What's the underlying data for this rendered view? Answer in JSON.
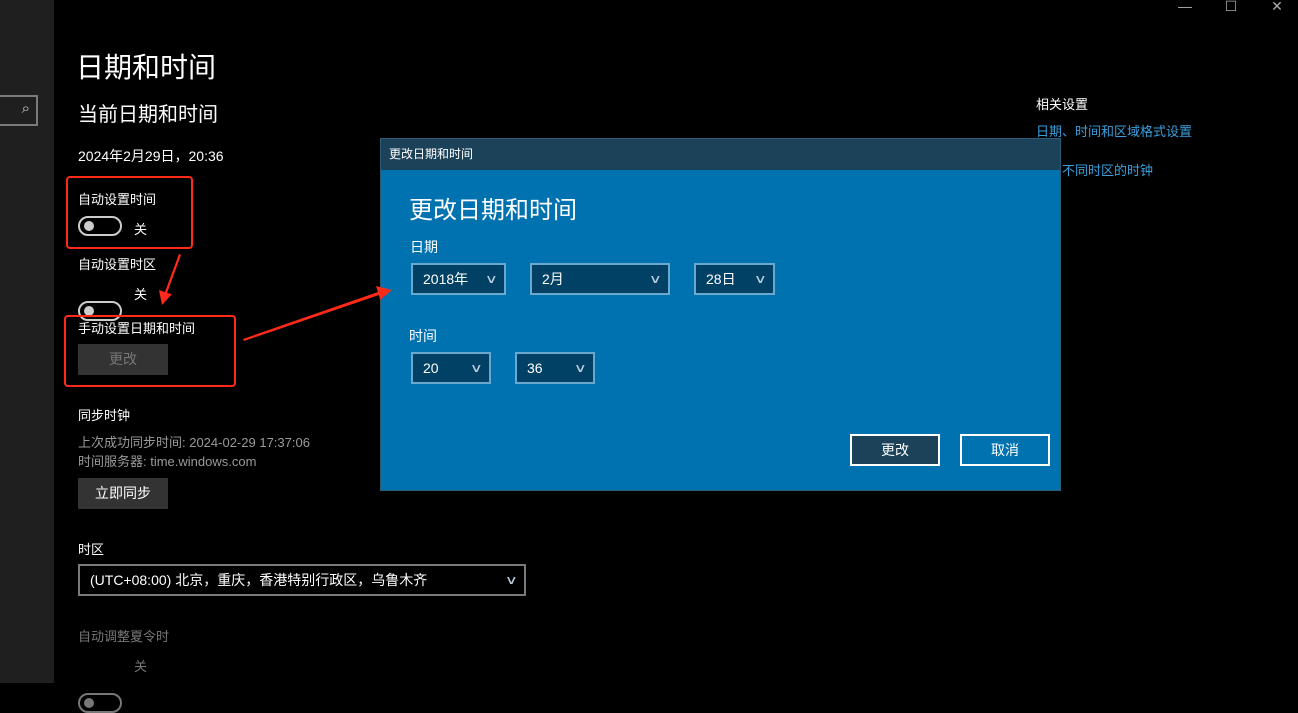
{
  "window": {
    "minimize": "—",
    "maximize": "☐",
    "close": "✕"
  },
  "page": {
    "title": "日期和时间",
    "section": "当前日期和时间",
    "current": "2024年2月29日，20:36"
  },
  "auto_time": {
    "label": "自动设置时间",
    "state": "关"
  },
  "auto_zone": {
    "label": "自动设置时区",
    "state": "关"
  },
  "manual": {
    "label": "手动设置日期和时间",
    "button": "更改"
  },
  "sync": {
    "title": "同步时钟",
    "last": "上次成功同步时间: 2024-02-29 17:37:06",
    "server": "时间服务器: time.windows.com",
    "button": "立即同步"
  },
  "timezone": {
    "label": "时区",
    "value": "(UTC+08:00) 北京，重庆，香港特别行政区，乌鲁木齐"
  },
  "dst": {
    "label": "自动调整夏令时",
    "state": "关"
  },
  "related": {
    "title": "相关设置",
    "link1": "日期、时间和区域格式设置",
    "link2": "添加不同时区的时钟"
  },
  "dialog": {
    "titlebar": "更改日期和时间",
    "heading": "更改日期和时间",
    "date_label": "日期",
    "year": "2018年",
    "month": "2月",
    "day": "28日",
    "time_label": "时间",
    "hour": "20",
    "minute": "36",
    "ok": "更改",
    "cancel": "取消"
  },
  "icons": {
    "search": "⌕",
    "chevron": "∨"
  }
}
